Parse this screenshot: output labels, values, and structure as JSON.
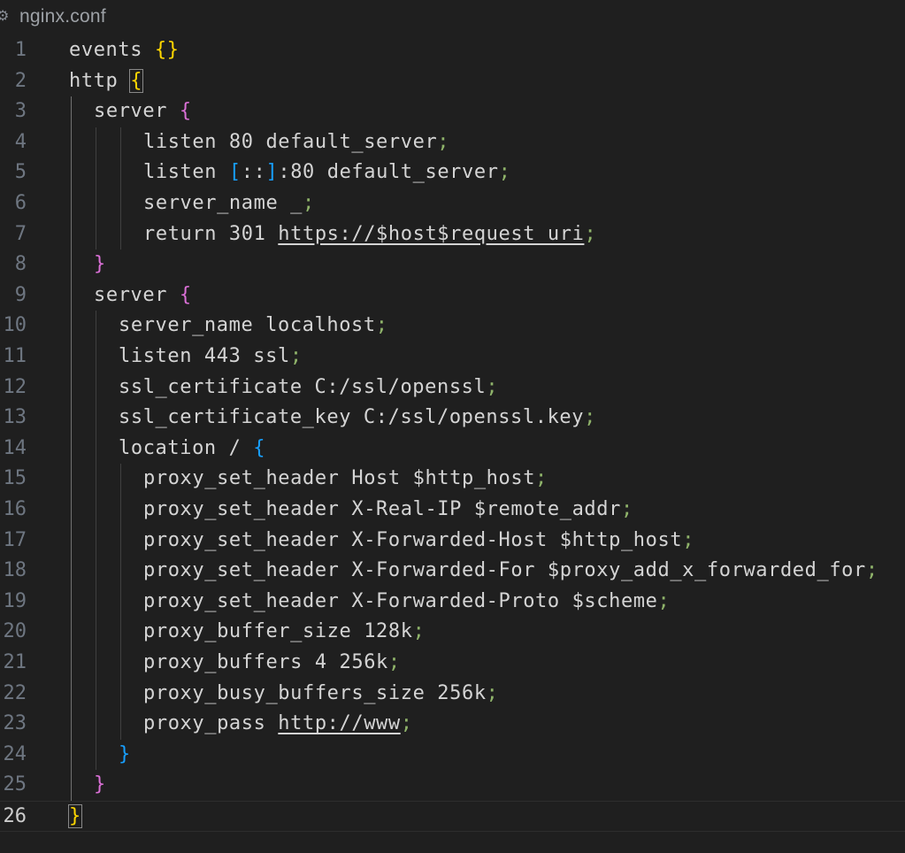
{
  "tab": {
    "icon": "gear-icon",
    "file_name": "nginx.conf"
  },
  "editor": {
    "current_line": 26,
    "lines": [
      {
        "n": "1",
        "indent": 0,
        "segs": [
          {
            "t": "events "
          },
          {
            "t": "{}",
            "c": "b1"
          }
        ]
      },
      {
        "n": "2",
        "indent": 0,
        "segs": [
          {
            "t": "http "
          },
          {
            "t": "{",
            "c": "b1 cursor-box"
          }
        ]
      },
      {
        "n": "3",
        "indent": 1,
        "segs": [
          {
            "t": "server "
          },
          {
            "t": "{",
            "c": "b2"
          }
        ]
      },
      {
        "n": "4",
        "indent": 3,
        "segs": [
          {
            "t": "listen 80 default_server"
          },
          {
            "t": ";",
            "c": "tok-punct"
          }
        ]
      },
      {
        "n": "5",
        "indent": 3,
        "segs": [
          {
            "t": "listen "
          },
          {
            "t": "[",
            "c": "b3"
          },
          {
            "t": "::"
          },
          {
            "t": "]",
            "c": "b3"
          },
          {
            "t": ":80 default_server"
          },
          {
            "t": ";",
            "c": "tok-punct"
          }
        ]
      },
      {
        "n": "6",
        "indent": 3,
        "segs": [
          {
            "t": "server_name _"
          },
          {
            "t": ";",
            "c": "tok-punct"
          }
        ]
      },
      {
        "n": "7",
        "indent": 3,
        "segs": [
          {
            "t": "return 301 "
          },
          {
            "t": "https://$host$request_uri",
            "c": "u"
          },
          {
            "t": ";",
            "c": "tok-punct"
          }
        ]
      },
      {
        "n": "8",
        "indent": 1,
        "segs": [
          {
            "t": "}",
            "c": "b2"
          }
        ]
      },
      {
        "n": "9",
        "indent": 1,
        "segs": [
          {
            "t": "server "
          },
          {
            "t": "{",
            "c": "b2"
          }
        ]
      },
      {
        "n": "10",
        "indent": 2,
        "segs": [
          {
            "t": "server_name localhost"
          },
          {
            "t": ";",
            "c": "tok-punct"
          }
        ]
      },
      {
        "n": "11",
        "indent": 2,
        "segs": [
          {
            "t": "listen 443 ssl"
          },
          {
            "t": ";",
            "c": "tok-punct"
          }
        ]
      },
      {
        "n": "12",
        "indent": 2,
        "segs": [
          {
            "t": "ssl_certificate C:/ssl/openssl"
          },
          {
            "t": ";",
            "c": "tok-punct"
          }
        ]
      },
      {
        "n": "13",
        "indent": 2,
        "segs": [
          {
            "t": "ssl_certificate_key C:/ssl/openssl.key"
          },
          {
            "t": ";",
            "c": "tok-punct"
          }
        ]
      },
      {
        "n": "14",
        "indent": 2,
        "segs": [
          {
            "t": "location / "
          },
          {
            "t": "{",
            "c": "b3"
          }
        ]
      },
      {
        "n": "15",
        "indent": 3,
        "segs": [
          {
            "t": "proxy_set_header Host $http_host"
          },
          {
            "t": ";",
            "c": "tok-punct"
          }
        ]
      },
      {
        "n": "16",
        "indent": 3,
        "segs": [
          {
            "t": "proxy_set_header X-Real-IP $remote_addr"
          },
          {
            "t": ";",
            "c": "tok-punct"
          }
        ]
      },
      {
        "n": "17",
        "indent": 3,
        "segs": [
          {
            "t": "proxy_set_header X-Forwarded-Host $http_host"
          },
          {
            "t": ";",
            "c": "tok-punct"
          }
        ]
      },
      {
        "n": "18",
        "indent": 3,
        "segs": [
          {
            "t": "proxy_set_header X-Forwarded-For $proxy_add_x_forwarded_for"
          },
          {
            "t": ";",
            "c": "tok-punct"
          }
        ]
      },
      {
        "n": "19",
        "indent": 3,
        "segs": [
          {
            "t": "proxy_set_header X-Forwarded-Proto $scheme"
          },
          {
            "t": ";",
            "c": "tok-punct"
          }
        ]
      },
      {
        "n": "20",
        "indent": 3,
        "segs": [
          {
            "t": "proxy_buffer_size 128k"
          },
          {
            "t": ";",
            "c": "tok-punct"
          }
        ]
      },
      {
        "n": "21",
        "indent": 3,
        "segs": [
          {
            "t": "proxy_buffers 4 256k"
          },
          {
            "t": ";",
            "c": "tok-punct"
          }
        ]
      },
      {
        "n": "22",
        "indent": 3,
        "segs": [
          {
            "t": "proxy_busy_buffers_size 256k"
          },
          {
            "t": ";",
            "c": "tok-punct"
          }
        ]
      },
      {
        "n": "23",
        "indent": 3,
        "segs": [
          {
            "t": "proxy_pass "
          },
          {
            "t": "http://www",
            "c": "u"
          },
          {
            "t": ";",
            "c": "tok-punct"
          }
        ]
      },
      {
        "n": "24",
        "indent": 2,
        "segs": [
          {
            "t": "}",
            "c": "b3"
          }
        ]
      },
      {
        "n": "25",
        "indent": 1,
        "segs": [
          {
            "t": "}",
            "c": "b2"
          }
        ]
      },
      {
        "n": "26",
        "indent": 0,
        "segs": [
          {
            "t": "}",
            "c": "b1 cursor-box"
          }
        ]
      }
    ]
  },
  "colors": {
    "background": "#1f1f1f",
    "text": "#d4d4d4",
    "line_number": "#6e7681",
    "bracket_level1": "#ffd700",
    "bracket_level2": "#da70d6",
    "bracket_level3": "#179fff",
    "punctuation": "#8fb36a"
  }
}
